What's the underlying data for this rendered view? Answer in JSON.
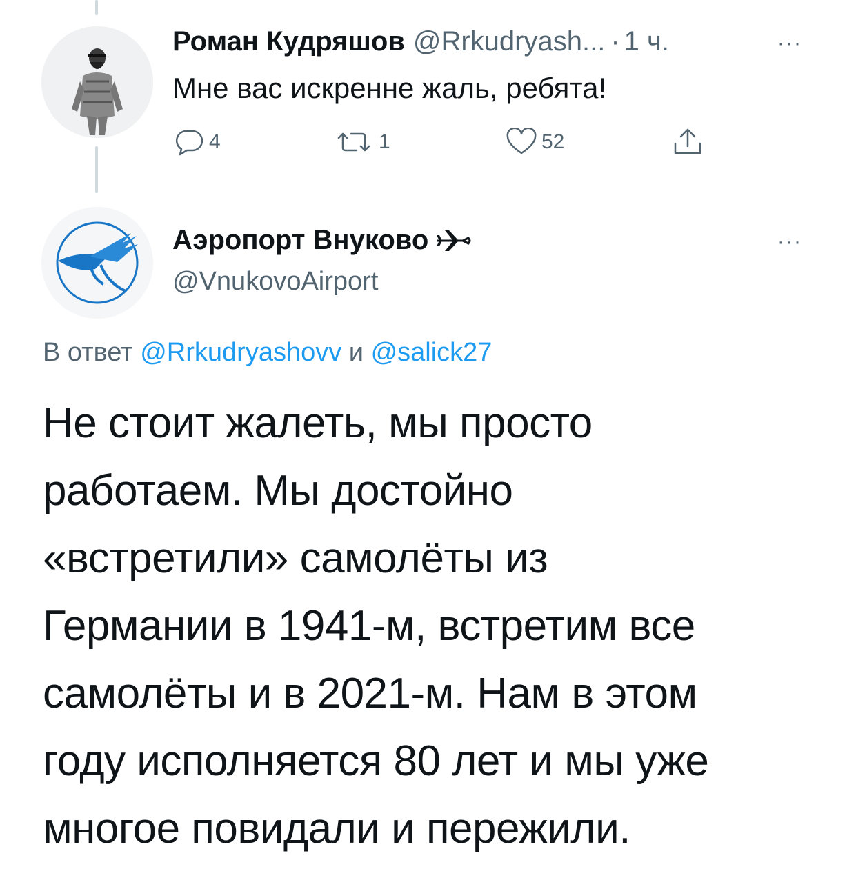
{
  "reply_tweet": {
    "author_name": "Роман Кудряшов",
    "author_handle": "@Rrkudryash...",
    "separator": "·",
    "time": "1 ч.",
    "more": "···",
    "text": "Мне вас искренне жаль, ребята!",
    "actions": {
      "reply_count": "4",
      "retweet_count": "1",
      "like_count": "52"
    }
  },
  "main_tweet": {
    "author_name": "Аэропорт Внуково",
    "author_name_icon": "airplane-icon",
    "author_handle": "@VnukovoAirport",
    "more": "···",
    "reply_prefix": "В ответ",
    "reply_mention_1": "@Rrkudryashovv",
    "reply_conjunction": "и",
    "reply_mention_2": "@salick27",
    "text_lines": [
      "Не стоит жалеть, мы просто",
      "работаем. Мы достойно",
      "«встретили» самолёты из",
      "Германии в 1941-м, встретим все",
      "самолёты и в 2021-м. Нам в этом",
      "году исполняется 80 лет и мы уже",
      "многое повидали и пережили."
    ]
  },
  "colors": {
    "text": "#0f1419",
    "secondary": "#536471",
    "link": "#1d9bf0",
    "thread_line": "#cfd9de"
  }
}
